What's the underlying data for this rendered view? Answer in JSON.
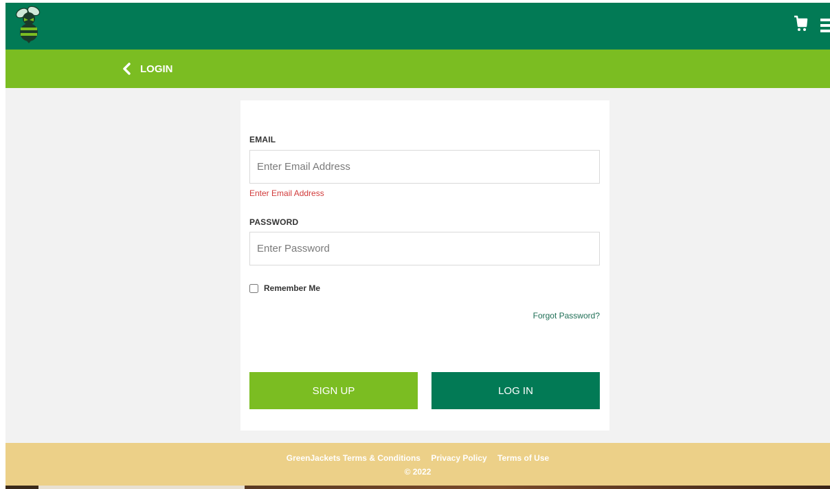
{
  "header": {
    "logo_icon": "yellowjacket-mascot-icon",
    "cart_icon": "shopping-cart-icon",
    "menu_icon": "hamburger-menu-icon",
    "brand_color": "#027a55"
  },
  "subheader": {
    "back_label": "LOGIN",
    "back_icon": "chevron-left-icon",
    "accent_color": "#7bbd22"
  },
  "form": {
    "email_label": "EMAIL",
    "email_placeholder": "Enter Email Address",
    "email_value": "",
    "email_error": "Enter Email Address",
    "password_label": "PASSWORD",
    "password_placeholder": "Enter Password",
    "password_value": "",
    "remember_label": "Remember Me",
    "remember_checked": false,
    "forgot_label": "Forgot Password?",
    "signup_label": "SIGN UP",
    "login_label": "LOG IN",
    "error_color": "#d13a3a"
  },
  "footer": {
    "links": [
      "GreenJackets Terms & Conditions",
      "Privacy Policy",
      "Terms of Use"
    ],
    "copyright": "© 2022",
    "background_color": "#ecd088"
  }
}
